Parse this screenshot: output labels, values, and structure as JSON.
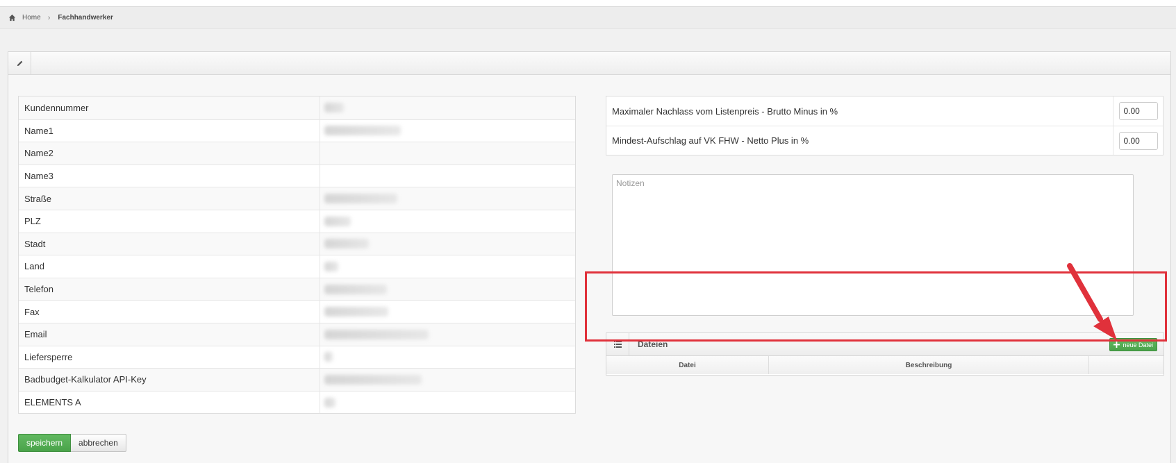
{
  "breadcrumb": {
    "home": "Home",
    "current": "Fachhandwerker"
  },
  "customer_fields": [
    {
      "label": "Kundennummer",
      "blur_w": 28
    },
    {
      "label": "Name1",
      "blur_w": 110
    },
    {
      "label": "Name2",
      "blur_w": 0
    },
    {
      "label": "Name3",
      "blur_w": 0
    },
    {
      "label": "Straße",
      "blur_w": 105
    },
    {
      "label": "PLZ",
      "blur_w": 38
    },
    {
      "label": "Stadt",
      "blur_w": 64
    },
    {
      "label": "Land",
      "blur_w": 20
    },
    {
      "label": "Telefon",
      "blur_w": 90
    },
    {
      "label": "Fax",
      "blur_w": 92
    },
    {
      "label": "Email",
      "blur_w": 150
    },
    {
      "label": "Liefersperre",
      "blur_w": 12
    },
    {
      "label": "Badbudget-Kalkulator API-Key",
      "blur_w": 140
    },
    {
      "label": "ELEMENTS A",
      "blur_w": 16
    }
  ],
  "buttons": {
    "save": "speichern",
    "cancel": "abbrechen"
  },
  "discount_fields": [
    {
      "label": "Maximaler Nachlass vom Listenpreis - Brutto Minus in %",
      "value": "0.00"
    },
    {
      "label": "Mindest-Aufschlag auf VK FHW - Netto Plus in %",
      "value": "0.00"
    }
  ],
  "notes": {
    "placeholder": "Notizen"
  },
  "files": {
    "title": "Dateien",
    "new_button": "neue Datei",
    "columns": [
      "Datei",
      "Beschreibung",
      ""
    ]
  },
  "colors": {
    "accent_green": "#4aa34a",
    "annotation_red": "#e0313b"
  }
}
